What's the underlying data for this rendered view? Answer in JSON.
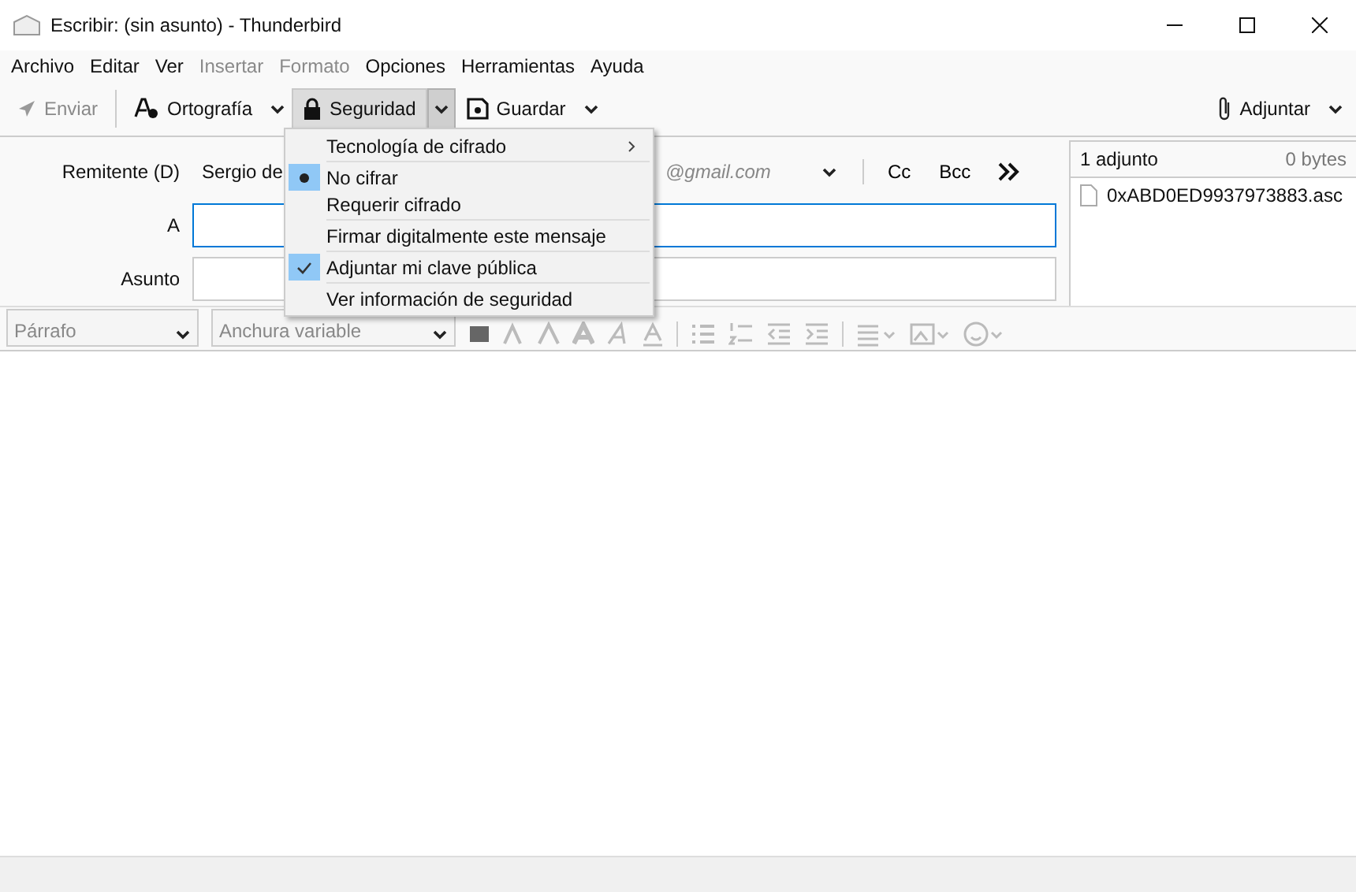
{
  "window": {
    "title": "Escribir: (sin asunto) - Thunderbird"
  },
  "menubar": [
    {
      "label": "Archivo",
      "disabled": false
    },
    {
      "label": "Editar",
      "disabled": false
    },
    {
      "label": "Ver",
      "disabled": false
    },
    {
      "label": "Insertar",
      "disabled": true
    },
    {
      "label": "Formato",
      "disabled": true
    },
    {
      "label": "Opciones",
      "disabled": false
    },
    {
      "label": "Herramientas",
      "disabled": false
    },
    {
      "label": "Ayuda",
      "disabled": false
    }
  ],
  "toolbar": [
    {
      "kind": "send",
      "label": "Enviar",
      "disabled": true
    },
    {
      "kind": "spell",
      "label": "Ortografía",
      "disabled": false
    },
    {
      "kind": "security",
      "label": "Seguridad",
      "disabled": false
    },
    {
      "kind": "save",
      "label": "Guardar",
      "disabled": false
    }
  ],
  "attach_button": {
    "label": "Adjuntar"
  },
  "header": {
    "from_label": "Remitente (D)",
    "from_name": "Sergio de",
    "from_email": "@gmail.com",
    "cc": "Cc",
    "bcc": "Bcc",
    "to_label": "A",
    "subject_label": "Asunto"
  },
  "attachments": {
    "count": "1 adjunto",
    "size": "0 bytes",
    "files": [
      "0xABD0ED9937973883.asc"
    ]
  },
  "format_bar": {
    "paragraph": "Párrafo",
    "font": "Anchura variable"
  },
  "security_menu": [
    {
      "kind": "submenu",
      "label": "Tecnología de cifrado"
    },
    {
      "kind": "radio",
      "label": "No cifrar",
      "selected": true,
      "separator_before": true
    },
    {
      "kind": "radio",
      "label": "Requerir cifrado",
      "selected": false
    },
    {
      "kind": "check",
      "label": "Firmar digitalmente este mensaje",
      "checked": false,
      "separator_before": true
    },
    {
      "kind": "check",
      "label": "Adjuntar mi clave pública",
      "checked": true,
      "separator_before": true
    },
    {
      "kind": "plain",
      "label": "Ver información de seguridad",
      "separator_before": true
    }
  ]
}
